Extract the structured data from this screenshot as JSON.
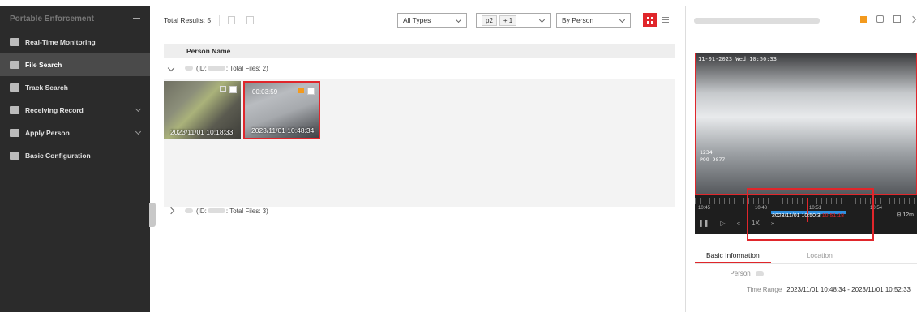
{
  "sidebar": {
    "title": "Portable Enforcement",
    "items": [
      {
        "label": "Real-Time Monitoring",
        "icon": "camera-icon"
      },
      {
        "label": "File Search",
        "icon": "folder-icon"
      },
      {
        "label": "Track Search",
        "icon": "track-icon"
      },
      {
        "label": "Receiving Record",
        "icon": "document-icon"
      },
      {
        "label": "Apply Person",
        "icon": "person-icon"
      },
      {
        "label": "Basic Configuration",
        "icon": "config-icon"
      }
    ]
  },
  "toolbar": {
    "total": "Total Results: 5",
    "type_select": "All Types",
    "device_tag": "p2",
    "device_more": "+ 1",
    "group_select": "By Person"
  },
  "list": {
    "column_header": "Person Name",
    "groups": [
      {
        "id_prefix": "(ID:",
        "files": ": Total Files: 2)"
      },
      {
        "id_prefix": "(ID:",
        "files": ": Total Files: 3)"
      }
    ],
    "tiles": [
      {
        "timestamp": "2023/11/01 10:18:33"
      },
      {
        "duration": "00:03:59",
        "timestamp": "2023/11/01 10:48:34"
      }
    ]
  },
  "player": {
    "osd_time": "11-01-2023 Wed 10:50:33",
    "osd_id_1": "1234",
    "osd_id_2": "P99 9877",
    "tick_labels": [
      "10:45",
      "10:48",
      "10:51",
      "10:54"
    ],
    "timeline_date": "2023/11/01 10:50:3",
    "timeline_red": "10:51:18",
    "speed": "1X",
    "zoom": "12m"
  },
  "details": {
    "tabs": [
      "Basic Information",
      "Location"
    ],
    "person_label": "Person",
    "time_range_label": "Time Range",
    "time_range_value": "2023/11/01 10:48:34 - 2023/11/01 10:52:33"
  },
  "colors": {
    "accent": "#e0262b",
    "sidebar": "#2b2b2b",
    "flag": "#f39a1e",
    "timeline_seg": "#2d8fe0"
  }
}
